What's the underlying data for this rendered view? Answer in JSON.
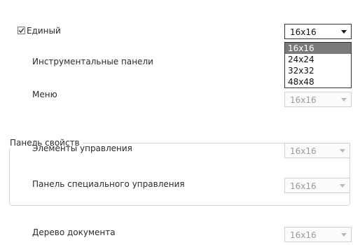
{
  "single": {
    "label": "Единый",
    "checked": true,
    "selected": "16x16",
    "options": [
      "16x16",
      "24x24",
      "32x32",
      "48x48"
    ]
  },
  "toolbars": {
    "label": "Инструментальные панели"
  },
  "menu": {
    "label": "Меню",
    "value": "16x16"
  },
  "properties": {
    "title": "Панель свойств",
    "controls": {
      "label": "Элементы управления",
      "value": "16x16"
    },
    "special": {
      "label": "Панель специального управления",
      "value": "16x16"
    }
  },
  "tree": {
    "label": "Дерево документа",
    "value": "16x16"
  },
  "colors": {
    "border_active": "#333333",
    "disabled_text": "#9b9b9b",
    "highlight": "#7a7a7a"
  }
}
